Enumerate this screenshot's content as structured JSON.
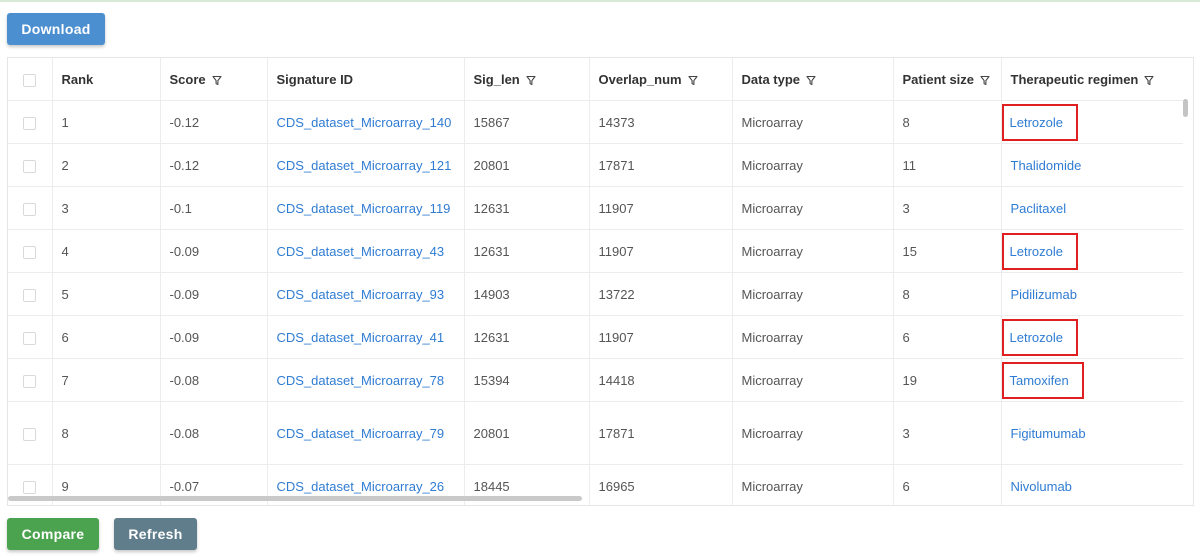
{
  "toolbar": {
    "download_label": "Download"
  },
  "table": {
    "columns": {
      "rank": "Rank",
      "score": "Score",
      "signature_id": "Signature ID",
      "sig_len": "Sig_len",
      "overlap_num": "Overlap_num",
      "data_type": "Data type",
      "patient_size": "Patient size",
      "therapeutic_regimen": "Therapeutic regimen"
    },
    "rows": [
      {
        "rank": "1",
        "score": "-0.12",
        "signature_id": "CDS_dataset_Microarray_140",
        "sig_len": "15867",
        "overlap_num": "14373",
        "data_type": "Microarray",
        "patient_size": "8",
        "therapeutic_regimen": "Letrozole",
        "highlighted": true
      },
      {
        "rank": "2",
        "score": "-0.12",
        "signature_id": "CDS_dataset_Microarray_121",
        "sig_len": "20801",
        "overlap_num": "17871",
        "data_type": "Microarray",
        "patient_size": "11",
        "therapeutic_regimen": "Thalidomide",
        "highlighted": false
      },
      {
        "rank": "3",
        "score": "-0.1",
        "signature_id": "CDS_dataset_Microarray_119",
        "sig_len": "12631",
        "overlap_num": "11907",
        "data_type": "Microarray",
        "patient_size": "3",
        "therapeutic_regimen": "Paclitaxel",
        "highlighted": false
      },
      {
        "rank": "4",
        "score": "-0.09",
        "signature_id": "CDS_dataset_Microarray_43",
        "sig_len": "12631",
        "overlap_num": "11907",
        "data_type": "Microarray",
        "patient_size": "15",
        "therapeutic_regimen": "Letrozole",
        "highlighted": true
      },
      {
        "rank": "5",
        "score": "-0.09",
        "signature_id": "CDS_dataset_Microarray_93",
        "sig_len": "14903",
        "overlap_num": "13722",
        "data_type": "Microarray",
        "patient_size": "8",
        "therapeutic_regimen": "Pidilizumab",
        "highlighted": false
      },
      {
        "rank": "6",
        "score": "-0.09",
        "signature_id": "CDS_dataset_Microarray_41",
        "sig_len": "12631",
        "overlap_num": "11907",
        "data_type": "Microarray",
        "patient_size": "6",
        "therapeutic_regimen": "Letrozole",
        "highlighted": true
      },
      {
        "rank": "7",
        "score": "-0.08",
        "signature_id": "CDS_dataset_Microarray_78",
        "sig_len": "15394",
        "overlap_num": "14418",
        "data_type": "Microarray",
        "patient_size": "19",
        "therapeutic_regimen": "Tamoxifen",
        "highlighted": true
      },
      {
        "rank": "8",
        "score": "-0.08",
        "signature_id": "CDS_dataset_Microarray_79",
        "sig_len": "20801",
        "overlap_num": "17871",
        "data_type": "Microarray",
        "patient_size": "3",
        "therapeutic_regimen": "Figitumumab",
        "highlighted": false
      },
      {
        "rank": "9",
        "score": "-0.07",
        "signature_id": "CDS_dataset_Microarray_26",
        "sig_len": "18445",
        "overlap_num": "16965",
        "data_type": "Microarray",
        "patient_size": "6",
        "therapeutic_regimen": "Nivolumab",
        "highlighted": false
      }
    ]
  },
  "footer": {
    "compare_label": "Compare",
    "refresh_label": "Refresh"
  },
  "colors": {
    "download_button": "#4b8fd0",
    "compare_button": "#4ba34f",
    "refresh_button": "#607d8b",
    "link": "#2f7cd3",
    "highlight_box": "#e02020"
  }
}
